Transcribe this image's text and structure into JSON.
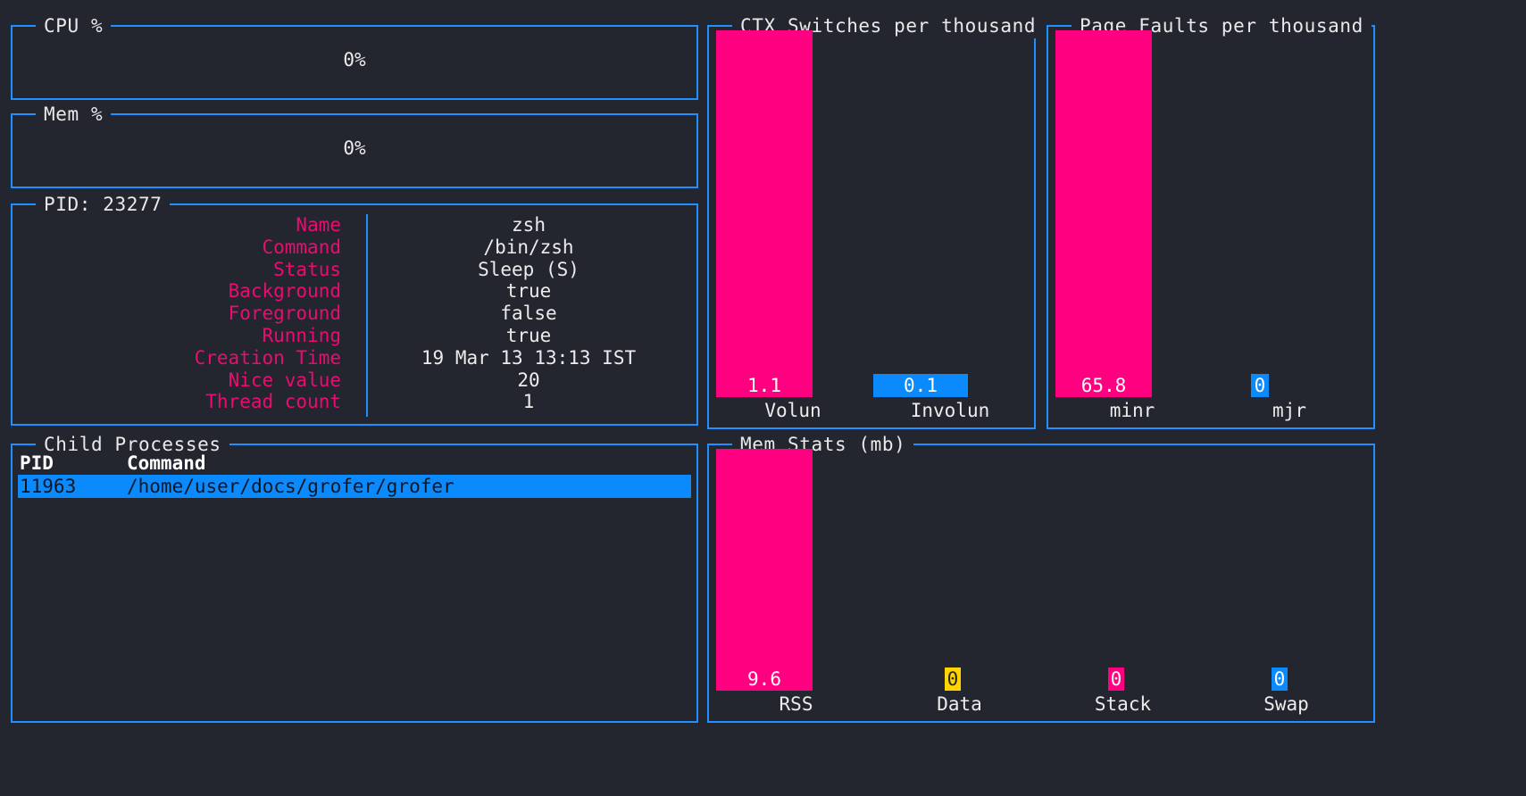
{
  "theme": {
    "background": "#23262e",
    "border": "#1e90ff",
    "magenta": "#ff0080",
    "blue": "#0a8afc",
    "yellow": "#ffd400",
    "text": "#ececec",
    "label_magenta": "#ec0b72"
  },
  "cpu_panel": {
    "title": "CPU %",
    "value": "0%"
  },
  "mem_panel": {
    "title": "Mem %",
    "value": "0%"
  },
  "pid_panel": {
    "title": "PID: 23277",
    "rows": [
      {
        "key": "Name",
        "value": "zsh"
      },
      {
        "key": "Command",
        "value": "/bin/zsh"
      },
      {
        "key": "Status",
        "value": "Sleep (S)"
      },
      {
        "key": "Background",
        "value": "true"
      },
      {
        "key": "Foreground",
        "value": "false"
      },
      {
        "key": "Running",
        "value": "true"
      },
      {
        "key": "Creation Time",
        "value": "19 Mar 13 13:13 IST"
      },
      {
        "key": "Nice value",
        "value": "20"
      },
      {
        "key": "Thread count",
        "value": "1"
      }
    ]
  },
  "child_processes": {
    "title": "Child Processes",
    "columns": [
      "PID",
      "Command"
    ],
    "rows": [
      {
        "pid": "11963",
        "command": "/home/user/docs/grofer/grofer",
        "selected": true
      }
    ]
  },
  "chart_data": [
    {
      "id": "ctx_switches",
      "type": "bar",
      "title": "CTX Switches per thousand",
      "categories": [
        "Volun",
        "Involun"
      ],
      "values": [
        1.1,
        0.1
      ],
      "labels": [
        "1.1",
        "0.1"
      ],
      "colors": [
        "#ff0080",
        "#0a8afc"
      ],
      "ylim": [
        0,
        1.15
      ],
      "xlabel": "",
      "ylabel": "",
      "grid": false,
      "legend": "none"
    },
    {
      "id": "page_faults",
      "type": "bar",
      "title": "Page Faults per thousand",
      "categories": [
        "minr",
        "mjr"
      ],
      "values": [
        65.8,
        0
      ],
      "labels": [
        "65.8",
        "0"
      ],
      "colors": [
        "#ff0080",
        "#0a8afc"
      ],
      "ylim": [
        0,
        68
      ],
      "xlabel": "",
      "ylabel": "",
      "grid": false,
      "legend": "none"
    },
    {
      "id": "mem_stats",
      "type": "bar",
      "title": "Mem Stats (mb)",
      "categories": [
        "RSS",
        "Data",
        "Stack",
        "Swap"
      ],
      "values": [
        9.6,
        0,
        0,
        0
      ],
      "labels": [
        "9.6",
        "0",
        "0",
        "0"
      ],
      "colors": [
        "#ff0080",
        "#ffd400",
        "#ff0080",
        "#0a8afc"
      ],
      "ylim": [
        0,
        10
      ],
      "xlabel": "",
      "ylabel": "",
      "grid": false,
      "legend": "none"
    }
  ]
}
